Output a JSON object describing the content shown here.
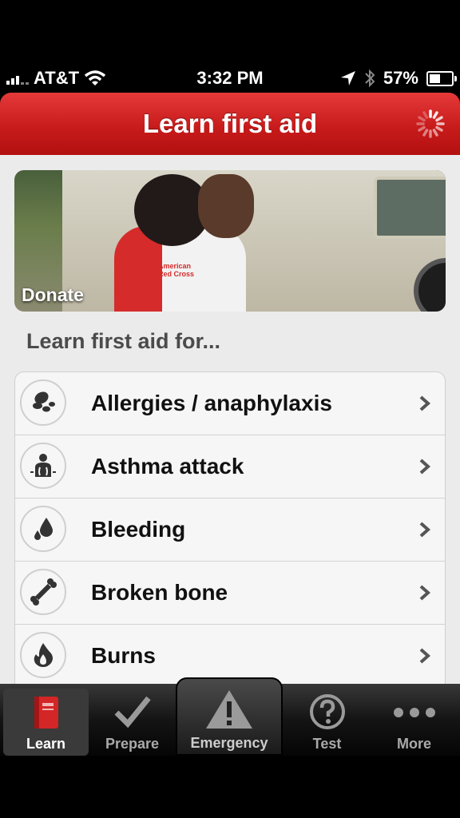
{
  "status_bar": {
    "carrier": "AT&T",
    "time": "3:32 PM",
    "battery": "57%",
    "battery_level": 0.57
  },
  "header": {
    "title": "Learn first aid"
  },
  "banner": {
    "label": "Donate",
    "vest_text_1": "American",
    "vest_text_2": "Red Cross"
  },
  "section_title": "Learn first aid for...",
  "topics": [
    {
      "label": "Allergies / anaphylaxis",
      "icon": "peanut-icon"
    },
    {
      "label": "Asthma attack",
      "icon": "lungs-icon"
    },
    {
      "label": "Bleeding",
      "icon": "blood-drop-icon"
    },
    {
      "label": "Broken bone",
      "icon": "bone-icon"
    },
    {
      "label": "Burns",
      "icon": "flame-icon"
    }
  ],
  "tabs": [
    {
      "label": "Learn",
      "icon": "book-icon",
      "active": true
    },
    {
      "label": "Prepare",
      "icon": "checkmark-icon"
    },
    {
      "label": "Emergency",
      "icon": "warning-icon"
    },
    {
      "label": "Test",
      "icon": "question-icon"
    },
    {
      "label": "More",
      "icon": "ellipsis-icon"
    }
  ],
  "colors": {
    "brand_red": "#c81b1b",
    "background": "#ebebeb"
  }
}
